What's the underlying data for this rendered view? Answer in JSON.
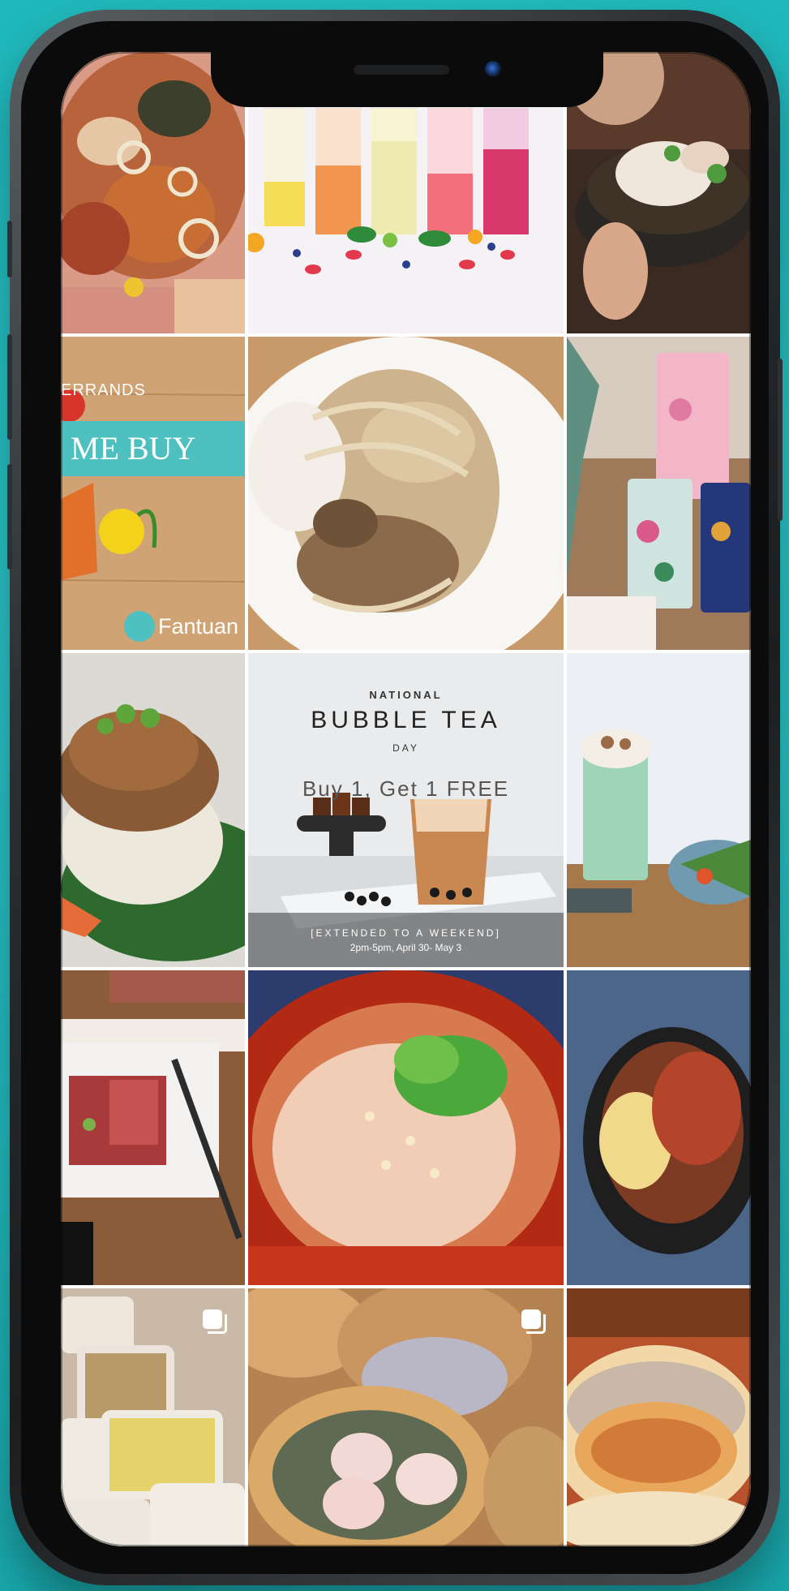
{
  "grid": {
    "posts": [
      {
        "id": "seafood-boil",
        "kind": "photo"
      },
      {
        "id": "fruit-teas",
        "kind": "photo"
      },
      {
        "id": "poke-bowl",
        "kind": "photo"
      },
      {
        "id": "errands-promo",
        "kind": "promo"
      },
      {
        "id": "udon-plate",
        "kind": "photo"
      },
      {
        "id": "floral-cups",
        "kind": "photo"
      },
      {
        "id": "pork-rice",
        "kind": "photo"
      },
      {
        "id": "bubble-tea-day",
        "kind": "promo"
      },
      {
        "id": "matcha-drink",
        "kind": "photo"
      },
      {
        "id": "raw-meat",
        "kind": "photo"
      },
      {
        "id": "spicy-jelly",
        "kind": "photo"
      },
      {
        "id": "noodle-bowl",
        "kind": "photo"
      },
      {
        "id": "meal-prep",
        "kind": "carousel"
      },
      {
        "id": "dim-sum",
        "kind": "carousel"
      },
      {
        "id": "toast-sandwich",
        "kind": "photo"
      }
    ]
  },
  "errands_post": {
    "small_label": "ERRANDS",
    "banner": "ME BUY",
    "brand": "Fantuan"
  },
  "bubble_tea_post": {
    "national": "NATIONAL",
    "title": "BUBBLE TEA",
    "day": "DAY",
    "promo": "Buy 1, Get 1 FREE",
    "extended": "[EXTENDED TO A WEEKEND]",
    "time": "2pm-5pm, April 30- May 3"
  },
  "colors": {
    "background": "#21c3c7",
    "brand_teal": "#4fc0c0",
    "frame": "#1b1d1f"
  }
}
